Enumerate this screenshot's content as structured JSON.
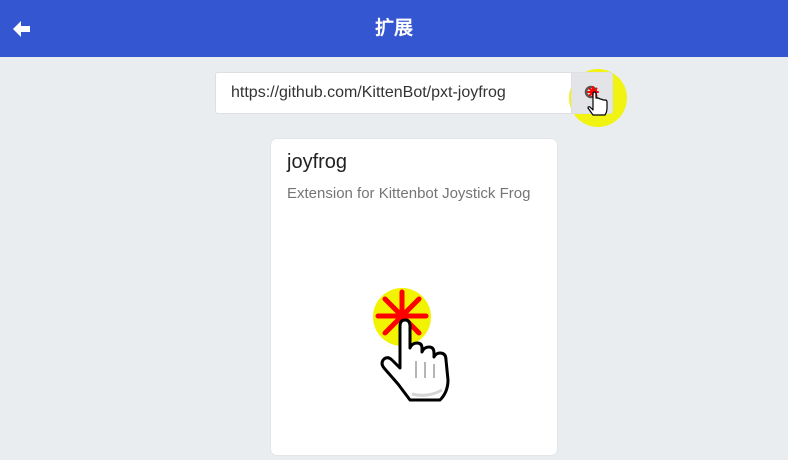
{
  "header": {
    "title": "扩展",
    "back_icon": "arrow-left-icon",
    "background": "#3456d1"
  },
  "search": {
    "value": "https://github.com/KittenBot/pxt-joyfrog",
    "button_icon": "search-icon"
  },
  "extension_card": {
    "name": "joyfrog",
    "description": "Extension for Kittenbot Joystick Frog"
  },
  "colors": {
    "page_background": "#eaedef",
    "click_highlight": "#f1f300",
    "click_burst": "#ff0000"
  }
}
